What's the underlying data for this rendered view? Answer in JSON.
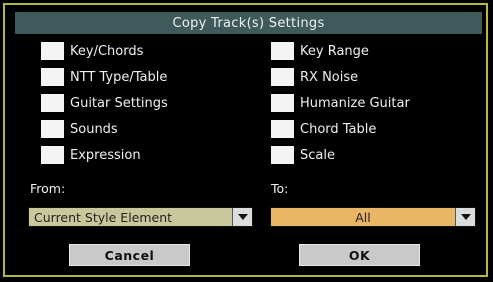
{
  "dialog": {
    "title": "Copy Track(s) Settings"
  },
  "left_options": [
    {
      "label": "Key/Chords"
    },
    {
      "label": "NTT Type/Table"
    },
    {
      "label": "Guitar Settings"
    },
    {
      "label": "Sounds"
    },
    {
      "label": "Expression"
    }
  ],
  "right_options": [
    {
      "label": "Key Range"
    },
    {
      "label": "RX Noise"
    },
    {
      "label": "Humanize Guitar"
    },
    {
      "label": "Chord Table"
    },
    {
      "label": "Scale"
    }
  ],
  "from": {
    "label": "From:",
    "value": "Current Style Element"
  },
  "to": {
    "label": "To:",
    "value": "All"
  },
  "buttons": {
    "cancel": "Cancel",
    "ok": "OK"
  },
  "colors": {
    "dialog_border": "#b8b83a",
    "title_bar": "#3e5a5a",
    "from_field": "#c9c89a",
    "to_field": "#e8b665"
  }
}
